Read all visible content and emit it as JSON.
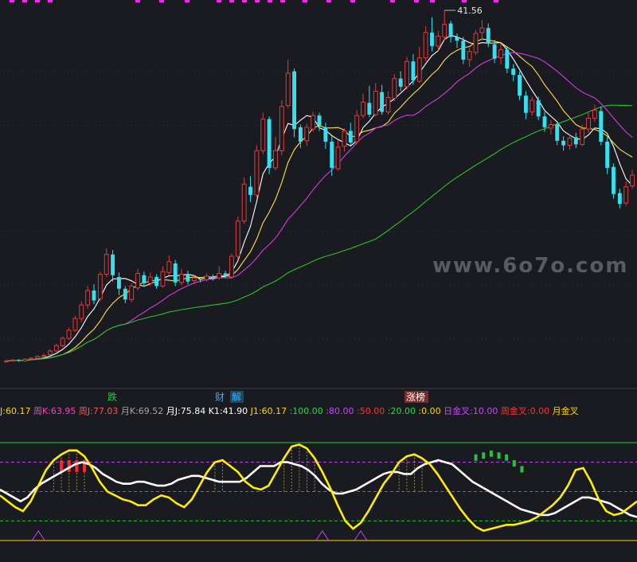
{
  "watermark": "www.6o7o.com",
  "price_high_label": "41.56",
  "tags": [
    {
      "text": "跌",
      "color": "#22cc44",
      "bg": ""
    },
    {
      "text": "财",
      "color": "#3fa9f5",
      "bg": ""
    },
    {
      "text": "解",
      "color": "#3fa9f5",
      "bg": "#184a66"
    },
    {
      "text": "涨榜",
      "color": "#ffffff",
      "bg": "#7a2a2a"
    }
  ],
  "indicator_readout": [
    {
      "label": "J:",
      "value": "60.17",
      "label_color": "#ffd400",
      "value_color": "#ffd400"
    },
    {
      "label": "周K:",
      "value": "63.95",
      "label_color": "#ff3fc6",
      "value_color": "#ff3fc6"
    },
    {
      "label": "周J:",
      "value": "77.03",
      "label_color": "#ff5555",
      "value_color": "#ff5555"
    },
    {
      "label": "月K:",
      "value": "69.52",
      "label_color": "#a6a6a6",
      "value_color": "#a6a6a6"
    },
    {
      "label": "月J:",
      "value": "75.84",
      "label_color": "#ffffff",
      "value_color": "#ffffff"
    },
    {
      "label": "K1:",
      "value": "41.90",
      "label_color": "#ffffff",
      "value_color": "#ffffff"
    },
    {
      "label": "J1:",
      "value": "60.17",
      "label_color": "#ffd400",
      "value_color": "#ffd400"
    },
    {
      "label": ":",
      "value": "100.00",
      "label_color": "#22dd44",
      "value_color": "#22dd44"
    },
    {
      "label": ":",
      "value": "80.00",
      "label_color": "#cc44ff",
      "value_color": "#cc44ff"
    },
    {
      "label": ":",
      "value": "50.00",
      "label_color": "#ff3333",
      "value_color": "#ff3333"
    },
    {
      "label": ":",
      "value": "20.00",
      "label_color": "#22dd44",
      "value_color": "#22dd44"
    },
    {
      "label": ":",
      "value": "0.00",
      "label_color": "#ffd400",
      "value_color": "#ffd400"
    },
    {
      "label": "日金叉:",
      "value": "10.00",
      "label_color": "#cc44ff",
      "value_color": "#cc44ff"
    },
    {
      "label": "周金叉:",
      "value": "0.00",
      "label_color": "#ff3333",
      "value_color": "#ff3333"
    },
    {
      "label": "月金叉",
      "value": "",
      "label_color": "#ffd400",
      "value_color": "#ffd400"
    }
  ],
  "colors": {
    "up": "#e03b3b",
    "down": "#36e0f0",
    "ma5": "#ffffff",
    "ma10": "#ffe14a",
    "ma20": "#d43be0",
    "ma60": "#29c229",
    "kd_white": "#ffffff",
    "kd_yellow": "#ffee00"
  },
  "chart_data": {
    "type": "candlestick",
    "ylim": [
      0,
      42
    ],
    "high_marker": 41.56,
    "candles": [
      [
        2.6,
        2.7,
        2.8,
        2.5
      ],
      [
        2.7,
        2.8,
        2.9,
        2.6
      ],
      [
        2.8,
        2.7,
        2.9,
        2.6
      ],
      [
        2.7,
        2.9,
        3.0,
        2.6
      ],
      [
        2.9,
        3.0,
        3.1,
        2.8
      ],
      [
        3.0,
        3.2,
        3.3,
        2.9
      ],
      [
        3.2,
        3.3,
        3.5,
        3.1
      ],
      [
        3.4,
        3.8,
        4.0,
        3.3
      ],
      [
        3.8,
        4.4,
        4.6,
        3.7
      ],
      [
        4.4,
        5.2,
        5.4,
        4.2
      ],
      [
        5.2,
        6.1,
        6.4,
        5.0
      ],
      [
        6.1,
        7.4,
        7.7,
        5.9
      ],
      [
        7.4,
        8.9,
        9.3,
        7.0
      ],
      [
        8.9,
        10.5,
        11.0,
        8.5
      ],
      [
        10.5,
        9.4,
        11.2,
        9.0
      ],
      [
        9.6,
        12.3,
        12.6,
        9.3
      ],
      [
        12.3,
        14.5,
        15.2,
        12.0
      ],
      [
        14.5,
        12.2,
        15.0,
        11.5
      ],
      [
        12.0,
        10.7,
        12.5,
        10.0
      ],
      [
        10.7,
        9.5,
        11.0,
        9.1
      ],
      [
        9.5,
        11.0,
        11.3,
        9.2
      ],
      [
        10.8,
        12.4,
        12.9,
        10.5
      ],
      [
        12.2,
        11.3,
        12.6,
        10.9
      ],
      [
        11.3,
        12.0,
        12.5,
        11.0
      ],
      [
        12.0,
        11.0,
        12.3,
        10.7
      ],
      [
        11.0,
        12.6,
        13.2,
        10.8
      ],
      [
        12.5,
        13.7,
        14.4,
        12.2
      ],
      [
        13.5,
        11.4,
        13.9,
        11.0
      ],
      [
        11.4,
        12.3,
        12.9,
        11.1
      ],
      [
        12.3,
        11.5,
        12.7,
        11.2
      ],
      [
        11.6,
        11.9,
        12.3,
        11.2
      ],
      [
        11.8,
        11.7,
        12.0,
        11.4
      ],
      [
        11.7,
        12.1,
        12.4,
        11.5
      ],
      [
        12.0,
        11.9,
        12.3,
        11.6
      ],
      [
        11.9,
        12.4,
        13.2,
        11.7
      ],
      [
        12.4,
        12.1,
        12.7,
        11.9
      ],
      [
        12.0,
        14.3,
        14.6,
        11.9
      ],
      [
        14.3,
        18.2,
        18.7,
        13.9
      ],
      [
        18.2,
        22.3,
        23.0,
        17.9
      ],
      [
        22.0,
        21.1,
        23.2,
        20.3
      ],
      [
        21.1,
        26.0,
        26.6,
        20.8
      ],
      [
        26.0,
        29.5,
        30.2,
        25.6
      ],
      [
        29.5,
        24.1,
        29.8,
        23.4
      ],
      [
        24.1,
        26.0,
        27.5,
        23.8
      ],
      [
        26.0,
        30.9,
        31.6,
        25.5
      ],
      [
        31.0,
        34.6,
        36.1,
        30.7
      ],
      [
        34.8,
        28.4,
        35.1,
        27.5
      ],
      [
        28.6,
        27.0,
        28.9,
        26.3
      ],
      [
        27.1,
        28.6,
        29.0,
        26.5
      ],
      [
        28.4,
        29.9,
        30.3,
        28.1
      ],
      [
        29.9,
        28.8,
        30.2,
        28.2
      ],
      [
        28.6,
        27.0,
        29.1,
        26.2
      ],
      [
        27.0,
        24.1,
        27.6,
        23.2
      ],
      [
        24.0,
        26.4,
        27.2,
        23.8
      ],
      [
        26.5,
        28.2,
        28.5,
        25.9
      ],
      [
        28.2,
        26.9,
        29.1,
        26.6
      ],
      [
        27.0,
        29.9,
        30.5,
        26.7
      ],
      [
        29.9,
        31.4,
        32.3,
        29.6
      ],
      [
        31.3,
        30.0,
        33.2,
        29.7
      ],
      [
        30.0,
        32.6,
        33.5,
        29.8
      ],
      [
        32.5,
        30.3,
        33.3,
        30.0
      ],
      [
        30.3,
        31.9,
        32.6,
        30.0
      ],
      [
        31.8,
        34.0,
        34.5,
        31.5
      ],
      [
        34.0,
        33.1,
        34.8,
        32.6
      ],
      [
        33.1,
        35.9,
        36.4,
        32.8
      ],
      [
        35.9,
        33.8,
        36.7,
        33.3
      ],
      [
        33.7,
        36.3,
        37.5,
        33.5
      ],
      [
        36.3,
        39.1,
        39.8,
        35.9
      ],
      [
        39.1,
        37.6,
        40.8,
        37.0
      ],
      [
        37.6,
        38.7,
        39.3,
        37.1
      ],
      [
        38.6,
        40.0,
        41.56,
        38.2
      ],
      [
        40.1,
        38.6,
        40.4,
        38.0
      ],
      [
        38.6,
        38.2,
        39.0,
        37.4
      ],
      [
        38.2,
        36.1,
        38.6,
        35.6
      ],
      [
        36.1,
        37.0,
        37.4,
        35.3
      ],
      [
        36.9,
        39.0,
        39.4,
        36.6
      ],
      [
        39.1,
        39.6,
        40.5,
        38.2
      ],
      [
        39.6,
        37.9,
        40.1,
        37.5
      ],
      [
        37.8,
        36.2,
        38.3,
        35.7
      ],
      [
        36.3,
        37.2,
        37.9,
        35.6
      ],
      [
        37.2,
        35.1,
        37.6,
        34.6
      ],
      [
        35.1,
        34.4,
        35.6,
        33.7
      ],
      [
        34.4,
        32.1,
        34.8,
        31.6
      ],
      [
        32.1,
        30.2,
        32.6,
        29.5
      ],
      [
        30.3,
        31.6,
        32.0,
        29.9
      ],
      [
        31.6,
        29.8,
        32.0,
        29.4
      ],
      [
        29.8,
        28.6,
        30.3,
        28.1
      ],
      [
        28.5,
        28.9,
        29.4,
        27.8
      ],
      [
        28.9,
        27.1,
        29.3,
        26.6
      ],
      [
        27.1,
        26.6,
        27.6,
        26.0
      ],
      [
        26.6,
        27.4,
        27.9,
        26.1
      ],
      [
        27.5,
        26.7,
        28.0,
        26.3
      ],
      [
        26.7,
        28.4,
        28.9,
        26.5
      ],
      [
        28.4,
        29.6,
        30.2,
        28.0
      ],
      [
        29.6,
        30.5,
        31.1,
        29.2
      ],
      [
        30.4,
        27.0,
        30.9,
        26.6
      ],
      [
        27.0,
        24.1,
        27.5,
        23.4
      ],
      [
        24.2,
        21.2,
        24.6,
        20.7
      ],
      [
        21.3,
        20.1,
        21.8,
        19.6
      ],
      [
        20.2,
        22.0,
        22.6,
        19.9
      ],
      [
        22.1,
        23.3,
        23.9,
        21.8
      ]
    ],
    "ma_periods": [
      5,
      10,
      20,
      60
    ],
    "kd_panel": {
      "ylim": [
        0,
        100
      ],
      "levels": [
        100,
        80,
        50,
        20,
        0
      ],
      "white": [
        52,
        48,
        44,
        40,
        44,
        52,
        58,
        62,
        66,
        70,
        74,
        78,
        80,
        78,
        74,
        68,
        64,
        60,
        58,
        58,
        60,
        60,
        58,
        56,
        56,
        58,
        62,
        64,
        66,
        66,
        64,
        62,
        60,
        60,
        60,
        60,
        64,
        70,
        76,
        76,
        76,
        80,
        80,
        78,
        76,
        72,
        66,
        58,
        52,
        48,
        48,
        50,
        52,
        56,
        60,
        64,
        68,
        70,
        70,
        68,
        68,
        74,
        78,
        80,
        82,
        80,
        78,
        72,
        66,
        60,
        56,
        52,
        48,
        44,
        40,
        36,
        32,
        30,
        28,
        26,
        26,
        28,
        32,
        36,
        40,
        44,
        44,
        42,
        40,
        38,
        34,
        30,
        26,
        24
      ],
      "yellow": [
        46,
        40,
        34,
        30,
        40,
        56,
        72,
        82,
        88,
        92,
        92,
        86,
        74,
        60,
        50,
        46,
        42,
        40,
        36,
        36,
        42,
        46,
        44,
        38,
        34,
        42,
        56,
        70,
        80,
        82,
        76,
        70,
        60,
        54,
        52,
        56,
        70,
        84,
        96,
        98,
        94,
        84,
        70,
        54,
        36,
        20,
        12,
        18,
        30,
        44,
        58,
        68,
        80,
        86,
        88,
        84,
        78,
        68,
        56,
        44,
        32,
        22,
        14,
        10,
        12,
        14,
        16,
        16,
        18,
        20,
        24,
        30,
        36,
        44,
        56,
        72,
        74,
        60,
        42,
        30,
        26,
        28,
        34,
        40
      ],
      "white_labels_at": [],
      "purple_arrows_idx": [
        5,
        42,
        47,
        84
      ]
    }
  }
}
